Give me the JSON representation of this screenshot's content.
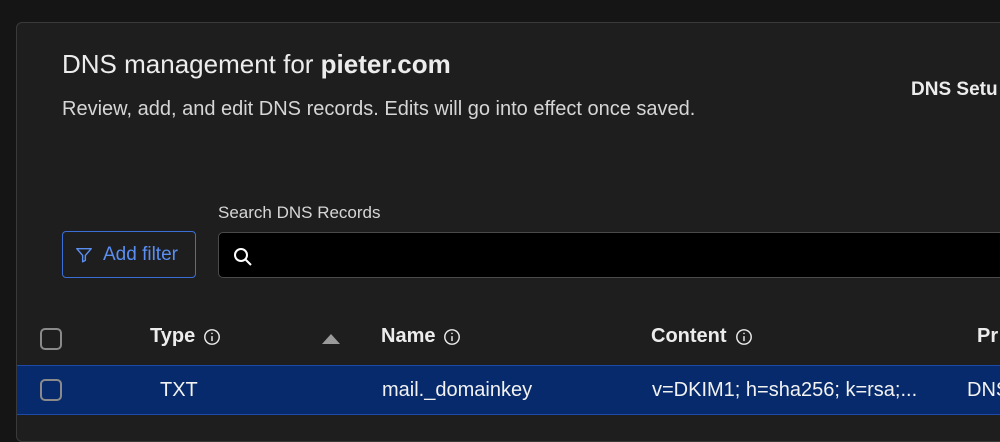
{
  "header": {
    "title_prefix": "DNS management for ",
    "domain": "pieter.com",
    "description": "Review, add, and edit DNS records. Edits will go into effect once saved.",
    "setup_link": "DNS Setu"
  },
  "filter": {
    "add_filter_label": "Add filter"
  },
  "search": {
    "label": "Search DNS Records",
    "value": "",
    "placeholder": ""
  },
  "table": {
    "columns": {
      "type": "Type",
      "name": "Name",
      "content": "Content",
      "proxy": "Pr"
    },
    "rows": [
      {
        "type": "TXT",
        "name": "mail._domainkey",
        "content": "v=DKIM1; h=sha256; k=rsa;...",
        "proxy": "DNS"
      }
    ]
  },
  "colors": {
    "accent": "#3b6ed9",
    "selected_row": "#062a6b",
    "background": "#1e1e1e"
  }
}
